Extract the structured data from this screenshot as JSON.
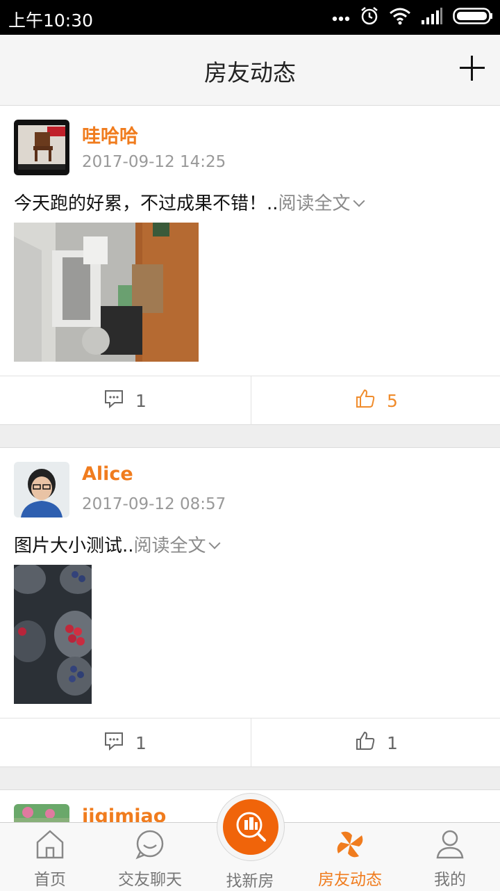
{
  "status_bar": {
    "time": "上午10:30"
  },
  "header": {
    "title": "房友动态"
  },
  "posts": [
    {
      "name": "哇哈哈",
      "time": "2017-09-12 14:25",
      "text": "今天跑的好累，不过成果不错！..",
      "read_more": "阅读全文",
      "comments": "1",
      "likes": "5",
      "liked": true
    },
    {
      "name": "Alice",
      "time": "2017-09-12 08:57",
      "text": "图片大小测试..",
      "read_more": "阅读全文",
      "comments": "1",
      "likes": "1",
      "liked": false
    },
    {
      "name": "jiqimiao"
    }
  ],
  "bottom_nav": [
    {
      "label": "首页",
      "icon": "home-icon"
    },
    {
      "label": "交友聊天",
      "icon": "chat-icon"
    },
    {
      "label": "找新房",
      "icon": "building-search-icon"
    },
    {
      "label": "房友动态",
      "icon": "pinwheel-icon",
      "active": true
    },
    {
      "label": "我的",
      "icon": "person-icon"
    }
  ],
  "colors": {
    "accent": "#f07c1e",
    "center_button": "#f0640a"
  }
}
